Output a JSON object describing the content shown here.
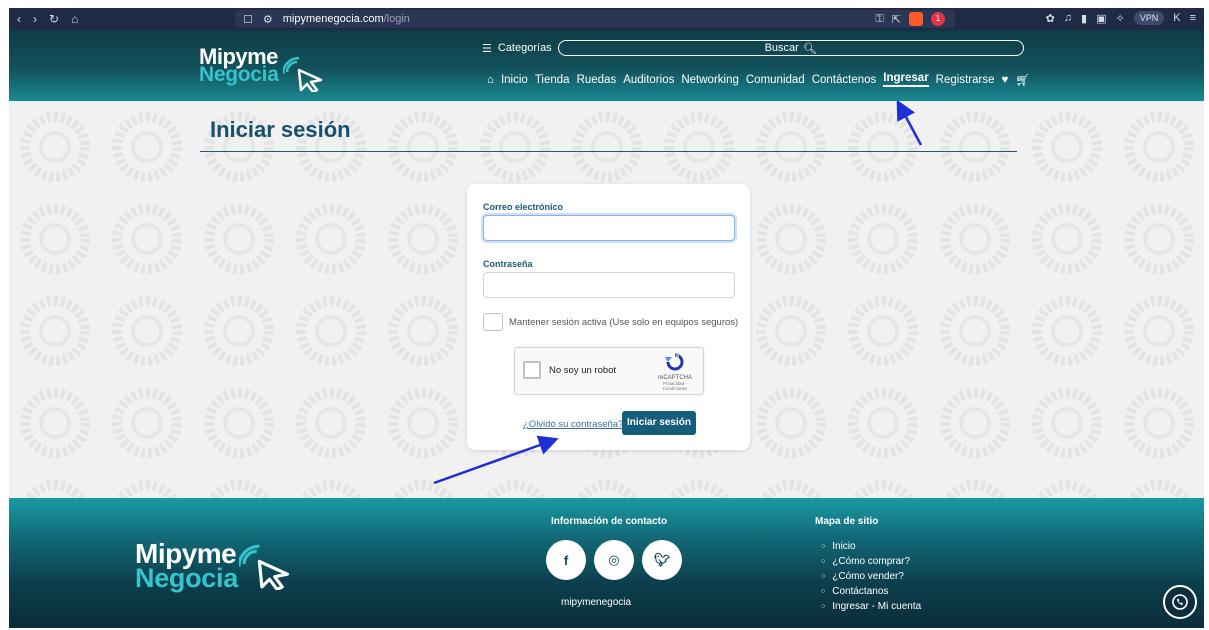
{
  "browser": {
    "url_host": "mipymenegocia.com",
    "url_path": "/login",
    "alert_count": "1",
    "vpn_label": "VPN"
  },
  "header": {
    "logo_line1": "Mipyme",
    "logo_line2": "Negocia",
    "categories_label": "Categorías",
    "search_label": "Buscar",
    "nav": {
      "inicio": "Inicio",
      "tienda": "Tienda",
      "ruedas": "Ruedas",
      "auditorios": "Auditorios",
      "networking": "Networking",
      "comunidad": "Comunidad",
      "contactenos": "Contáctenos",
      "ingresar": "Ingresar",
      "registrarse": "Registrarse"
    }
  },
  "page": {
    "title": "Iniciar sesión"
  },
  "form": {
    "email_label": "Correo electrónico",
    "email_value": "",
    "password_label": "Contraseña",
    "password_value": "",
    "remember_label": "Mantener sesión activa (Use solo en equipos seguros)",
    "remember_checked": false,
    "captcha_text": "No soy un robot",
    "captcha_brand": "reCAPTCHA",
    "captcha_terms": "Privacidad - Condiciones",
    "forgot_link": "¿Olvidó su contraseña?",
    "submit_label": "Iniciar sesión"
  },
  "footer": {
    "logo_line1": "Mipyme",
    "logo_line2": "Negocia",
    "contact_heading": "Información de contacto",
    "site_name": "mipymenegocia",
    "sitemap_heading": "Mapa de sitio",
    "sitemap": [
      "Inicio",
      "¿Cómo comprar?",
      "¿Cómo vender?",
      "Contáctanos",
      "Ingresar - Mi cuenta"
    ]
  },
  "colors": {
    "brand_dark": "#12525c",
    "brand_accent": "#35c3cc",
    "title": "#17506b",
    "button": "#165d7a",
    "annotation_arrow": "#1f2fd6"
  }
}
